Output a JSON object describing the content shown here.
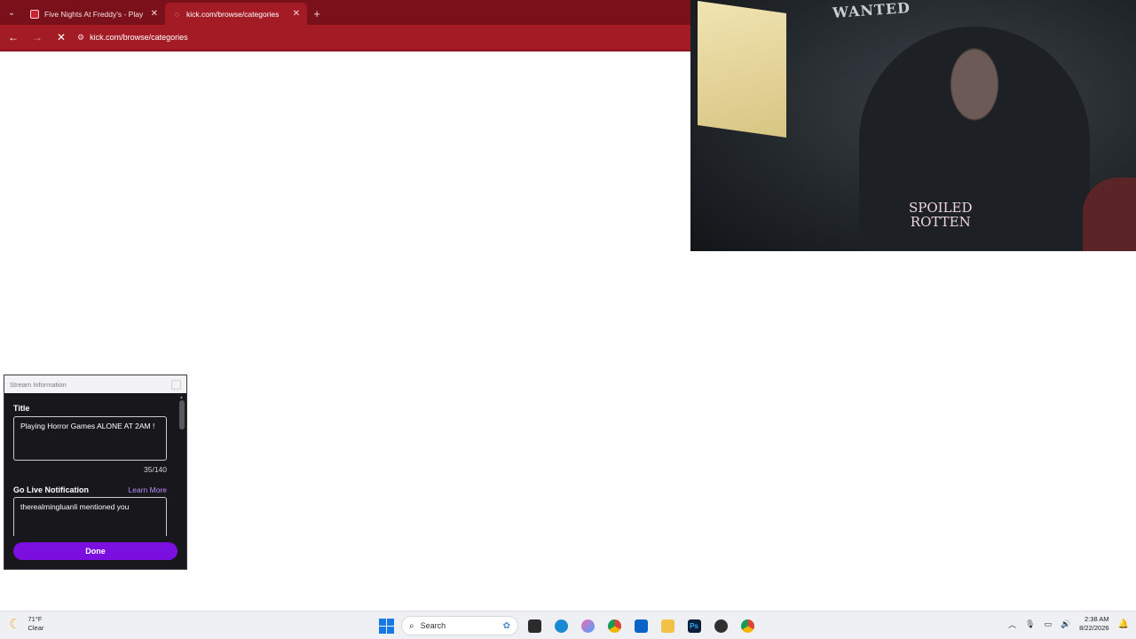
{
  "browser": {
    "tabs": [
      {
        "title": "Five Nights At Freddy's - Play Fr",
        "active": false
      },
      {
        "title": "kick.com/browse/categories",
        "active": true
      }
    ],
    "new_tab_glyph": "+",
    "url": "kick.com/browse/categories",
    "accent_color": "#a31c25"
  },
  "webcam": {
    "poster_text": "WANTED",
    "shirt_line1": "SPOILED",
    "shirt_line2": "ROTTEN"
  },
  "dock": {
    "window_title": "Stream Information",
    "title_label": "Title",
    "title_value": "Playing Horror Games ALONE AT 2AM !",
    "title_counter": "35/140",
    "notification_label": "Go Live Notification",
    "learn_more": "Learn More",
    "notification_value": "therealmingluanli mentioned you",
    "done_label": "Done",
    "accent_color": "#7b0fe0"
  },
  "taskbar": {
    "weather_temp": "71°F",
    "weather_desc": "Clear",
    "search_placeholder": "Search",
    "clock_time": "2:38 AM",
    "clock_date": "8/22/2026"
  }
}
